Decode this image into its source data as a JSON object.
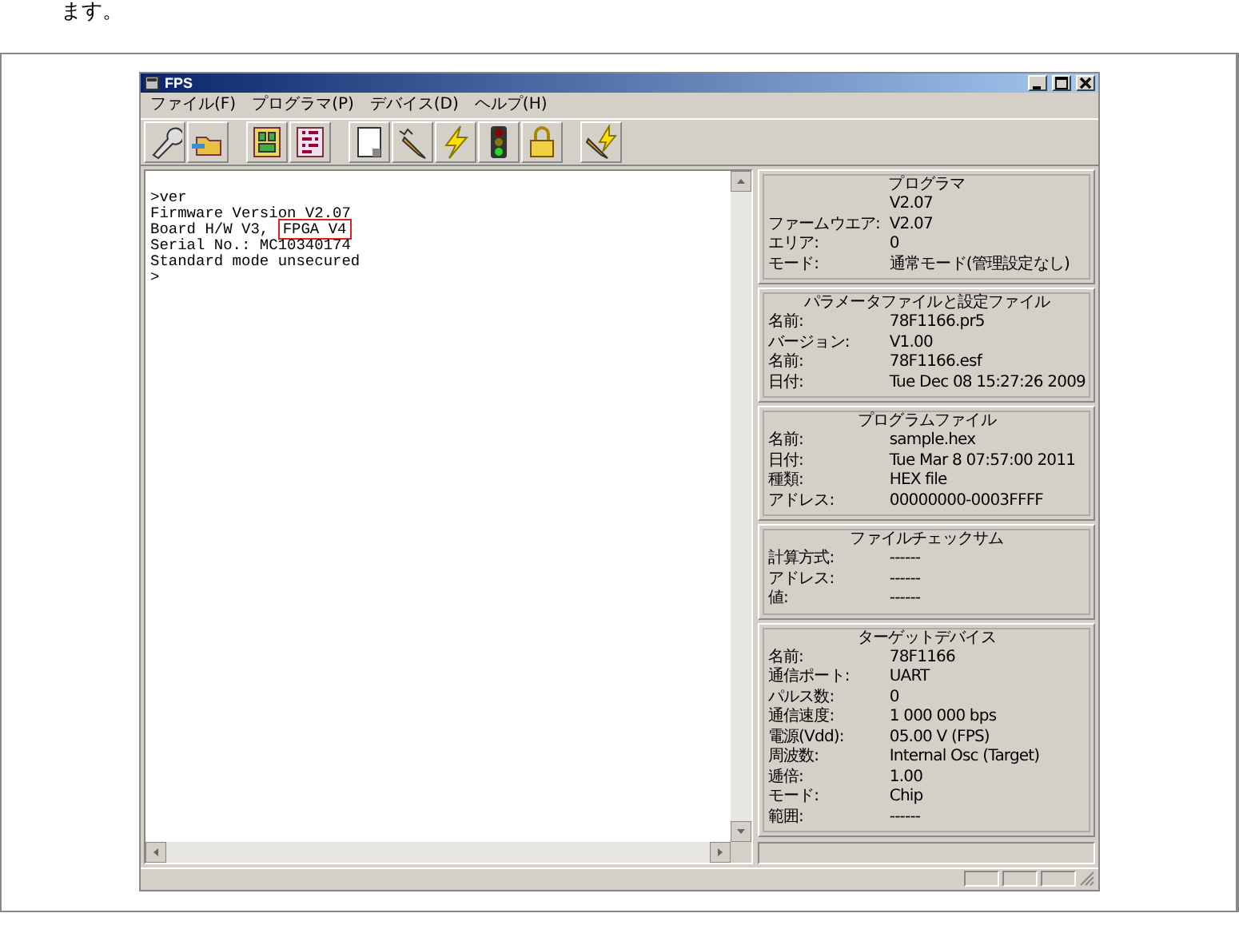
{
  "intro_text": "ます。",
  "window": {
    "title": "FPS"
  },
  "menu": [
    {
      "label": "ファイル(F)"
    },
    {
      "label": "プログラマ(P)"
    },
    {
      "label": "デバイス(D)"
    },
    {
      "label": "ヘルプ(H)"
    }
  ],
  "toolbar": [
    {
      "buttons": [
        {
          "kind": "wrench"
        },
        {
          "kind": "folder"
        }
      ]
    },
    {
      "buttons": [
        {
          "kind": "chip"
        },
        {
          "kind": "binary"
        }
      ]
    },
    {
      "buttons": [
        {
          "kind": "page"
        },
        {
          "kind": "pencil"
        },
        {
          "kind": "lightning"
        },
        {
          "kind": "traffic"
        },
        {
          "kind": "lock"
        }
      ]
    },
    {
      "buttons": [
        {
          "kind": "pencil_lightning"
        }
      ]
    }
  ],
  "console": {
    "lines": [
      {
        "text": ">ver"
      },
      {
        "text": "Firmware Version V2.07"
      },
      {
        "text": "Board H/W V3, ",
        "marked": "FPGA V4"
      },
      {
        "text": "Serial No.: MC10340174"
      },
      {
        "text": "Standard mode unsecured"
      },
      {
        "text": ">"
      }
    ]
  },
  "panels": [
    {
      "title": "プログラマ",
      "rows": [
        {
          "value": "V2.07"
        },
        {
          "label": "ファームウエア:",
          "value": "V2.07"
        },
        {
          "label": "エリア:",
          "value": "0"
        },
        {
          "label": "モード:",
          "value": "通常モード(管理設定なし)"
        }
      ]
    },
    {
      "title": "パラメータファイルと設定ファイル",
      "rows": [
        {
          "label": "名前:",
          "value": "78F1166.pr5"
        },
        {
          "label": "バージョン:",
          "value": "V1.00"
        },
        {
          "label": "名前:",
          "value": "78F1166.esf"
        },
        {
          "label": "日付:",
          "value": "Tue Dec 08 15:27:26 2009"
        }
      ]
    },
    {
      "title": "プログラムファイル",
      "rows": [
        {
          "label": "名前:",
          "value": "sample.hex"
        },
        {
          "label": "日付:",
          "value": "Tue Mar  8 07:57:00 2011"
        },
        {
          "label": "種類:",
          "value": "HEX file"
        },
        {
          "label": "アドレス:",
          "value": "00000000-0003FFFF"
        }
      ]
    },
    {
      "title": "ファイルチェックサム",
      "rows": [
        {
          "label": "計算方式:",
          "value": "------"
        },
        {
          "label": "アドレス:",
          "value": "------"
        },
        {
          "label": "値:",
          "value": "------"
        }
      ]
    },
    {
      "title": "ターゲットデバイス",
      "rows": [
        {
          "label": "名前:",
          "value": "78F1166"
        },
        {
          "label": "通信ポート:",
          "value": "UART"
        },
        {
          "label": "パルス数:",
          "value": "0"
        },
        {
          "label": "通信速度:",
          "value": "1 000 000 bps"
        },
        {
          "label": "電源(Vdd):",
          "value": "05.00 V (FPS)"
        },
        {
          "label": "周波数:",
          "value": "Internal Osc (Target)"
        },
        {
          "label": "逓倍:",
          "value": "1.00"
        },
        {
          "label": "モード:",
          "value": "Chip"
        },
        {
          "label": "範囲:",
          "value": "------"
        }
      ]
    }
  ]
}
